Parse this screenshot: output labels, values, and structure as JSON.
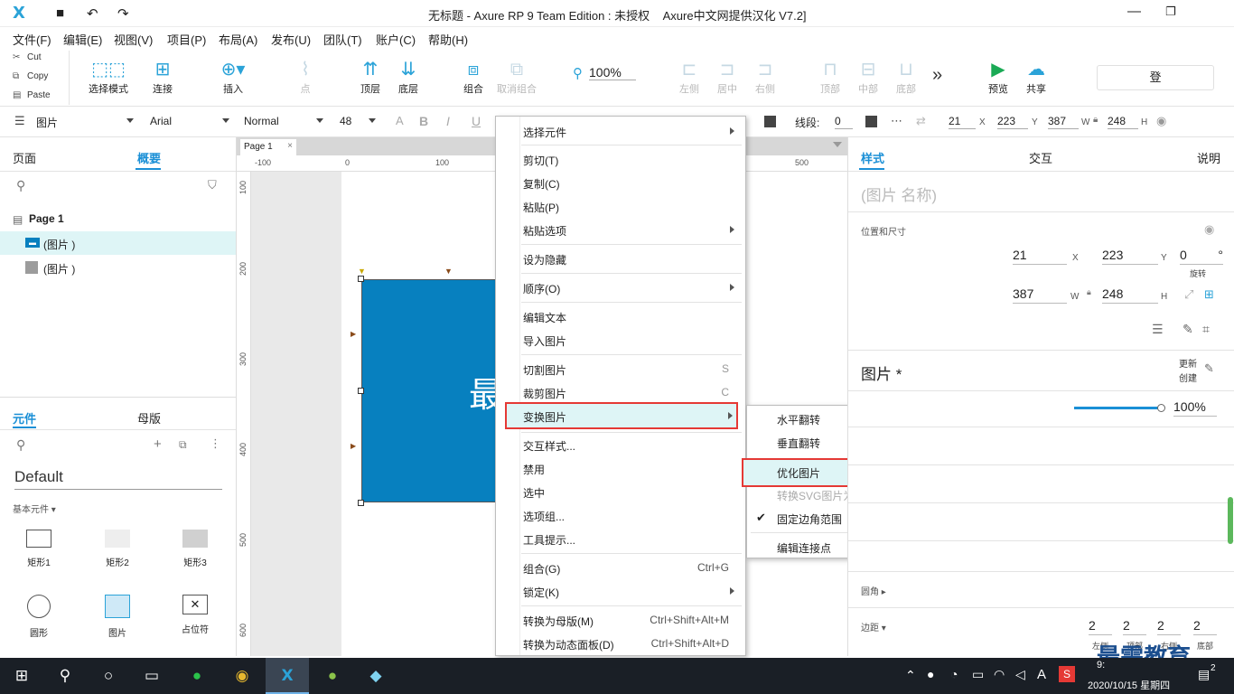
{
  "window": {
    "title": "无标题 - Axure RP 9 Team Edition : 未授权",
    "subtitle": "Axure中文网提供汉化 V7.2]"
  },
  "menubar": [
    "文件(F)",
    "编辑(E)",
    "视图(V)",
    "项目(P)",
    "布局(A)",
    "发布(U)",
    "团队(T)",
    "账户(C)",
    "帮助(H)"
  ],
  "clipboard": [
    "Cut",
    "Copy",
    "Paste"
  ],
  "toolbar": {
    "select_mode": "选择模式",
    "connect": "连接",
    "insert": "插入",
    "point": "点",
    "top_layer": "顶层",
    "bottom_layer": "底层",
    "group": "组合",
    "ungroup": "取消组合",
    "zoom": "100%",
    "align": [
      "左侧",
      "居中",
      "右侧",
      "顶部",
      "中部",
      "底部"
    ],
    "more": "»",
    "preview": "预览",
    "share": "共享",
    "login": "登"
  },
  "format": {
    "element_type": "图片",
    "font": "Arial",
    "style": "Normal",
    "size": "48",
    "stroke_label": "线段:",
    "stroke_value": "0",
    "x": "21",
    "y": "223",
    "w": "387",
    "h": "248",
    "x_label": "X",
    "y_label": "Y",
    "w_label": "W",
    "h_label": "H"
  },
  "leftpanel": {
    "tabs": [
      "页面",
      "概要"
    ],
    "page_name": "Page 1",
    "outline_items": [
      "(图片 )",
      "(图片 )"
    ],
    "lib_tabs": [
      "元件",
      "母版"
    ],
    "library": "Default",
    "category": "基本元件",
    "widgets": [
      "矩形1",
      "矩形2",
      "矩形3",
      "圆形",
      "图片",
      "占位符"
    ]
  },
  "canvas": {
    "tab": "Page 1",
    "ruler_h": [
      "-100",
      "0",
      "100",
      "500"
    ],
    "ruler_v": [
      "100",
      "200",
      "300",
      "400",
      "500",
      "600"
    ],
    "canvas_text": "最"
  },
  "context_menu": {
    "items": [
      {
        "label": "选择元件",
        "shortcut": "",
        "submenu": true
      },
      {
        "label": "剪切(T)",
        "shortcut": "",
        "submenu": false
      },
      {
        "label": "复制(C)",
        "shortcut": "",
        "submenu": false
      },
      {
        "label": "粘贴(P)",
        "shortcut": "",
        "submenu": false
      },
      {
        "label": "粘贴选项",
        "shortcut": "",
        "submenu": true
      },
      {
        "label": "设为隐藏",
        "shortcut": "",
        "submenu": false
      },
      {
        "label": "顺序(O)",
        "shortcut": "",
        "submenu": true
      },
      {
        "label": "编辑文本",
        "shortcut": "",
        "submenu": false
      },
      {
        "label": "导入图片",
        "shortcut": "",
        "submenu": false
      },
      {
        "label": "切割图片",
        "shortcut": "S",
        "submenu": false
      },
      {
        "label": "裁剪图片",
        "shortcut": "C",
        "submenu": false
      },
      {
        "label": "变换图片",
        "shortcut": "",
        "submenu": true
      },
      {
        "label": "交互样式...",
        "shortcut": "",
        "submenu": false
      },
      {
        "label": "禁用",
        "shortcut": "",
        "submenu": false
      },
      {
        "label": "选中",
        "shortcut": "",
        "submenu": false
      },
      {
        "label": "选项组...",
        "shortcut": "",
        "submenu": false
      },
      {
        "label": "工具提示...",
        "shortcut": "",
        "submenu": false
      },
      {
        "label": "组合(G)",
        "shortcut": "Ctrl+G",
        "submenu": false
      },
      {
        "label": "锁定(K)",
        "shortcut": "",
        "submenu": true
      },
      {
        "label": "转换为母版(M)",
        "shortcut": "Ctrl+Shift+Alt+M",
        "submenu": false
      },
      {
        "label": "转换为动态面板(D)",
        "shortcut": "Ctrl+Shift+Alt+D",
        "submenu": false
      }
    ]
  },
  "submenu": {
    "items": [
      "水平翻转",
      "垂直翻转",
      "优化图片",
      "转换SVG图片为形状",
      "固定边角范围",
      "编辑连接点"
    ]
  },
  "rightpanel": {
    "tabs": [
      "样式",
      "交互",
      "说明"
    ],
    "name_placeholder": "(图片 名称)",
    "pos_size_label": "位置和尺寸",
    "x": "21",
    "y": "223",
    "rotation": "0",
    "rotation_label": "旋转",
    "w": "387",
    "h": "248",
    "deg": "°",
    "section_title": "图片 *",
    "update_label": "更新",
    "create_label": "创建",
    "opacity": "100%",
    "corner_label": "圆角",
    "padding_label": "边距",
    "padding_values": [
      "2",
      "2",
      "2",
      "2"
    ],
    "padding_names": [
      "左侧",
      "顶部",
      "右侧",
      "底部"
    ]
  },
  "taskbar": {
    "time": "9:",
    "date": "2020/10/15 星期四",
    "ime": "A",
    "badge": "2"
  },
  "watermark": "最需教育",
  "colors": {
    "accent": "#1a8fd6",
    "image_fill": "#0780bf",
    "highlight_border": "#e53935",
    "taskbar": "#1a1f26"
  }
}
